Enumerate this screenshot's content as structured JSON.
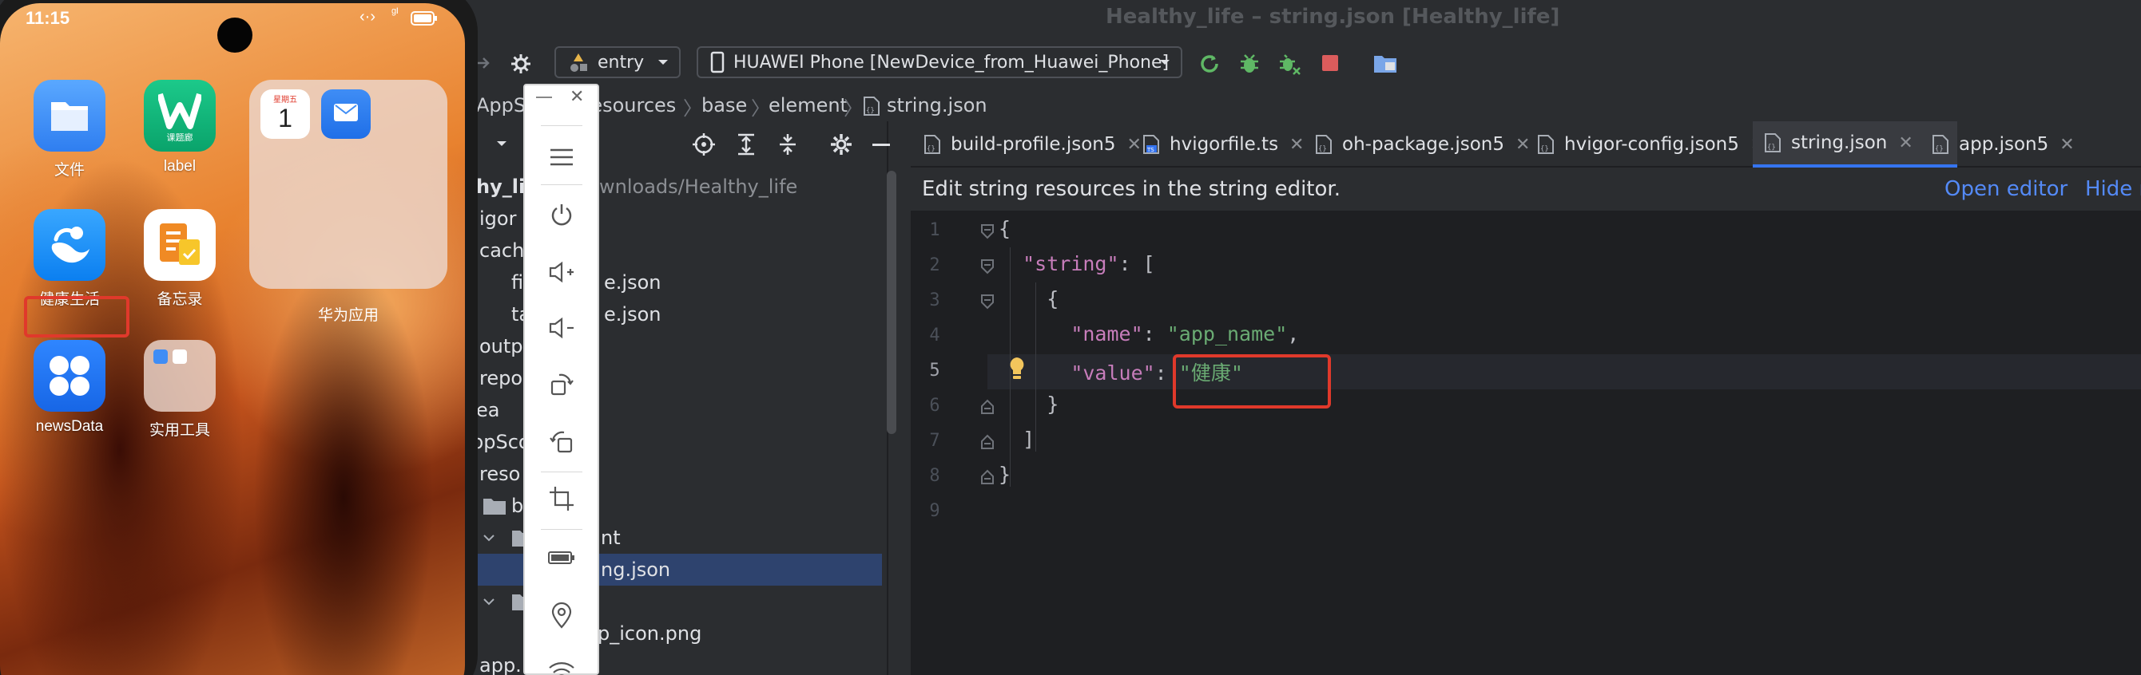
{
  "window": {
    "title": "Healthy_life – string.json [Healthy_life]"
  },
  "toolbar": {
    "module": "entry",
    "device": "HUAWEI Phone [NewDevice_from_Huawei_Phone]"
  },
  "breadcrumbs": [
    "AppS",
    "resources",
    "base",
    "element",
    "string.json"
  ],
  "project": {
    "rows": [
      {
        "text": "hy_li",
        "extra": "wnloads/Healthy_life",
        "bold": true
      },
      {
        "text": "igor",
        "extra": ""
      },
      {
        "text": "cach",
        "extra": ""
      },
      {
        "text": "fi",
        "extra": "e.json"
      },
      {
        "text": "ta",
        "extra": "e.json"
      },
      {
        "text": "outp",
        "extra": ""
      },
      {
        "text": "repo",
        "extra": ""
      },
      {
        "text": "ea",
        "extra": ""
      },
      {
        "text": "ppSco",
        "extra": ""
      },
      {
        "text": "reso",
        "extra": ""
      },
      {
        "text": "b",
        "extra": ""
      },
      {
        "text": "",
        "extra": "nt"
      },
      {
        "text": "",
        "extra": "ng.json"
      },
      {
        "text": "",
        "extra": ""
      },
      {
        "text": "",
        "extra": "p_icon.png"
      },
      {
        "text": "app.",
        "extra": ""
      }
    ]
  },
  "tabs": [
    {
      "label": "build-profile.json5",
      "icon": "json-file-icon"
    },
    {
      "label": "hvigorfile.ts",
      "icon": "ts-file-icon"
    },
    {
      "label": "oh-package.json5",
      "icon": "json-file-icon"
    },
    {
      "label": "hvigor-config.json5",
      "icon": "json-file-icon"
    },
    {
      "label": "string.json",
      "icon": "json-file-icon",
      "active": true
    },
    {
      "label": "app.json5",
      "icon": "json-file-icon"
    }
  ],
  "banner": {
    "message": "Edit string resources in the string editor.",
    "open_editor": "Open editor",
    "hide": "Hide n"
  },
  "editor": {
    "line_numbers": [
      "1",
      "2",
      "3",
      "4",
      "5",
      "6",
      "7",
      "8",
      "9"
    ],
    "lines": {
      "l1": "{",
      "l2_key": "\"string\"",
      "l2_rest": ": [",
      "l3": "{",
      "l4_key": "\"name\"",
      "l4_sep": ": ",
      "l4_val": "\"app_name\"",
      "l4_end": ",",
      "l5_key": "\"value\"",
      "l5_sep": ": ",
      "l5_val": "\"健康\"",
      "l6": "}",
      "l7": "]",
      "l8": "}"
    }
  },
  "phone": {
    "time": "11:15",
    "apps": [
      {
        "label": "文件",
        "icon": "files-app-icon"
      },
      {
        "label": "label",
        "icon": "label-app-icon"
      },
      {
        "label": "健康生活",
        "icon": "health-life-app-icon"
      },
      {
        "label": "备忘录",
        "icon": "notepad-app-icon"
      },
      {
        "label": "newsData",
        "icon": "newsdata-app-icon"
      },
      {
        "label": "实用工具",
        "icon": "tools-folder-icon"
      }
    ],
    "folder": {
      "label": "华为应用",
      "calendar_weekday": "星期五",
      "calendar_day": "1"
    },
    "label_app_text": "课题廊"
  },
  "colors": {
    "accent": "#3574f0",
    "link": "#548af7",
    "highlight_box": "#e0392b",
    "string_literal": "#6aab73",
    "json_key": "#c77dbb"
  }
}
